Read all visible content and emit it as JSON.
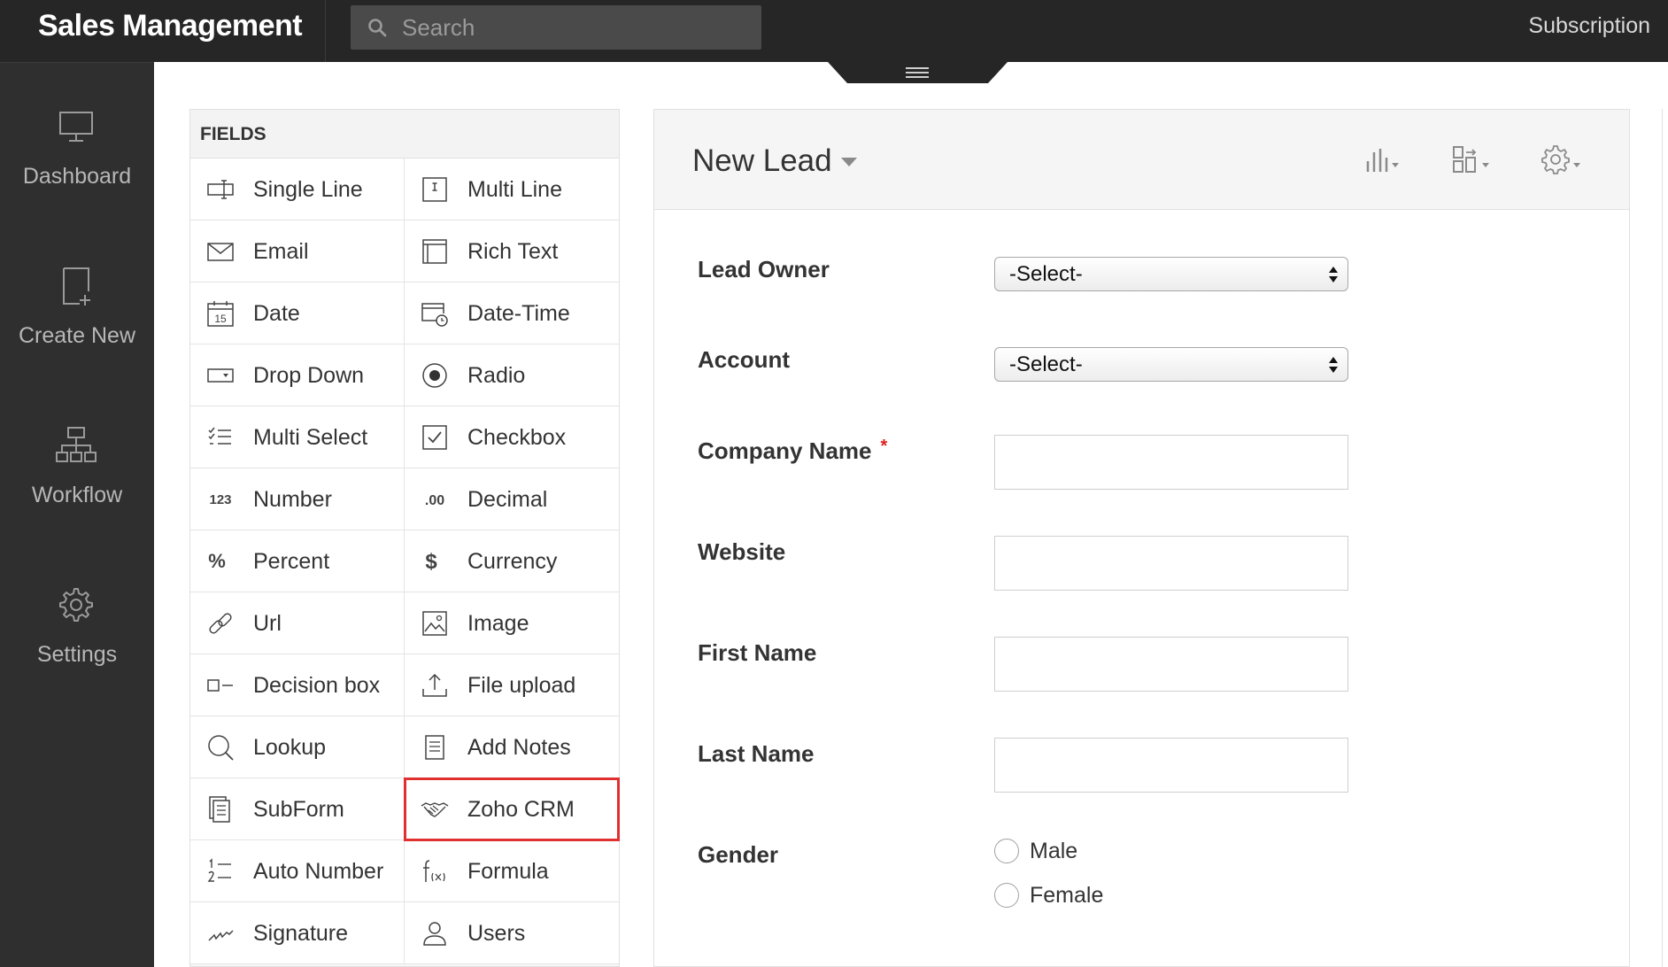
{
  "app": {
    "title": "Sales Management",
    "subscription_label": "Subscription"
  },
  "search": {
    "placeholder": "Search",
    "icon": "search-icon"
  },
  "sidebar": {
    "items": [
      {
        "label": "Dashboard",
        "icon": "monitor-icon"
      },
      {
        "label": "Create New",
        "icon": "new-page-icon"
      },
      {
        "label": "Workflow",
        "icon": "workflow-icon"
      },
      {
        "label": "Settings",
        "icon": "gear-icon"
      }
    ]
  },
  "fields_panel": {
    "header": "FIELDS",
    "items": [
      {
        "label": "Single Line",
        "icon": "single-line-icon"
      },
      {
        "label": "Multi Line",
        "icon": "multi-line-icon"
      },
      {
        "label": "Email",
        "icon": "envelope-icon"
      },
      {
        "label": "Rich Text",
        "icon": "rich-text-icon"
      },
      {
        "label": "Date",
        "icon": "calendar-icon"
      },
      {
        "label": "Date-Time",
        "icon": "calendar-clock-icon"
      },
      {
        "label": "Drop Down",
        "icon": "dropdown-icon"
      },
      {
        "label": "Radio",
        "icon": "radio-icon"
      },
      {
        "label": "Multi Select",
        "icon": "checklist-icon"
      },
      {
        "label": "Checkbox",
        "icon": "checkbox-icon"
      },
      {
        "label": "Number",
        "icon": "number-icon"
      },
      {
        "label": "Decimal",
        "icon": "decimal-icon"
      },
      {
        "label": "Percent",
        "icon": "percent-icon"
      },
      {
        "label": "Currency",
        "icon": "dollar-icon"
      },
      {
        "label": "Url",
        "icon": "link-icon"
      },
      {
        "label": "Image",
        "icon": "image-icon"
      },
      {
        "label": "Decision box",
        "icon": "decision-box-icon"
      },
      {
        "label": "File upload",
        "icon": "upload-icon"
      },
      {
        "label": "Lookup",
        "icon": "magnifier-icon"
      },
      {
        "label": "Add Notes",
        "icon": "notes-icon"
      },
      {
        "label": "SubForm",
        "icon": "subform-icon"
      },
      {
        "label": "Zoho CRM",
        "icon": "handshake-icon"
      },
      {
        "label": "Auto Number",
        "icon": "auto-number-icon"
      },
      {
        "label": "Formula",
        "icon": "formula-icon"
      },
      {
        "label": "Signature",
        "icon": "signature-icon"
      },
      {
        "label": "Users",
        "icon": "user-icon"
      }
    ],
    "number_icon_text": "123",
    "decimal_icon_text": ".00",
    "percent_icon_text": "%",
    "currency_icon_text": "$",
    "date_icon_text": "15",
    "highlighted_item": "Zoho CRM",
    "highlight_color": "#e03030"
  },
  "form": {
    "title": "New Lead",
    "toolbar": [
      "bar-chart-icon",
      "layout-icon",
      "gear-icon"
    ],
    "fields": {
      "lead_owner": {
        "label": "Lead Owner",
        "value": "-Select-"
      },
      "account": {
        "label": "Account",
        "value": "-Select-"
      },
      "company_name": {
        "label": "Company Name",
        "required_mark": "*",
        "value": ""
      },
      "website": {
        "label": "Website",
        "value": ""
      },
      "first_name": {
        "label": "First Name",
        "value": ""
      },
      "last_name": {
        "label": "Last Name",
        "value": ""
      },
      "gender": {
        "label": "Gender",
        "options": [
          "Male",
          "Female"
        ]
      }
    }
  },
  "colors": {
    "topbar": "#262626",
    "sidebar": "#2f2f2f",
    "required": "#e02020"
  }
}
